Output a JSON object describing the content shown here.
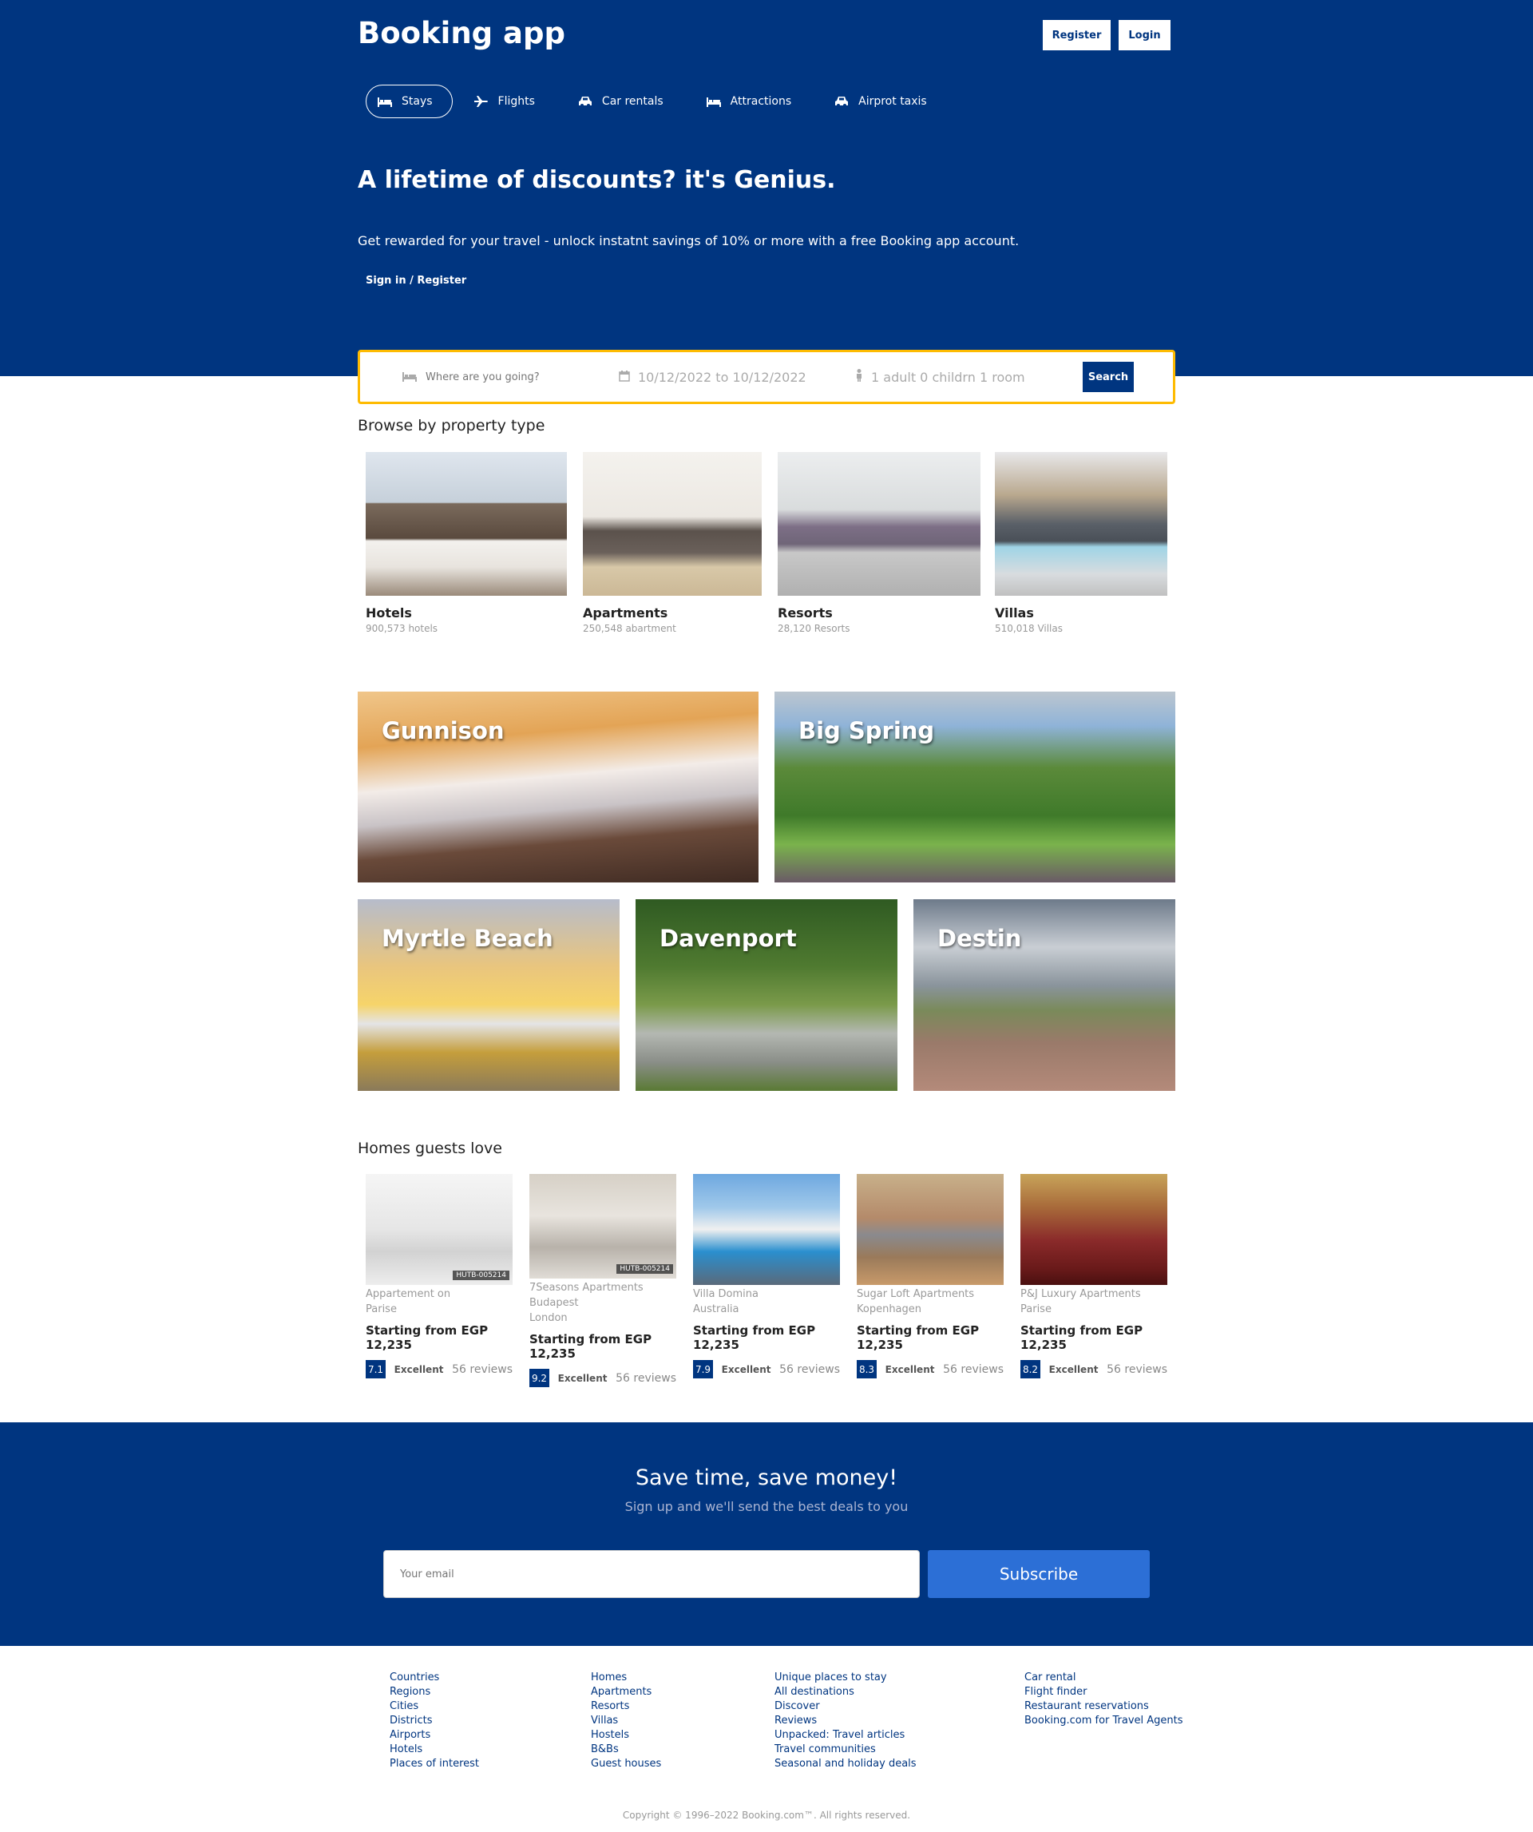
{
  "header": {
    "brand": "Booking app",
    "register_label": "Register",
    "login_label": "Login",
    "nav": [
      {
        "label": "Stays",
        "icon": "bed-icon"
      },
      {
        "label": "Flights",
        "icon": "plane-icon"
      },
      {
        "label": "Car rentals",
        "icon": "car-icon"
      },
      {
        "label": "Attractions",
        "icon": "bed-icon"
      },
      {
        "label": "Airprot taxis",
        "icon": "taxi-icon"
      }
    ],
    "hero_title": "A lifetime of discounts? it's Genius.",
    "hero_subtitle": "Get rewarded for your travel - unlock instatnt savings of 10% or more with a free Booking app account.",
    "hero_link": "Sign in / Register"
  },
  "search": {
    "destination_placeholder": "Where are you going?",
    "dates": "10/12/2022 to 10/12/2022",
    "guests": "1 adult 0 childrn 1 room",
    "button_label": "Search"
  },
  "property_types": {
    "title": "Browse by property type",
    "items": [
      {
        "name": "Hotels",
        "count": "900,573 hotels"
      },
      {
        "name": "Apartments",
        "count": "250,548 abartment"
      },
      {
        "name": "Resorts",
        "count": "28,120 Resorts"
      },
      {
        "name": "Villas",
        "count": "510,018 Villas"
      }
    ]
  },
  "cities": [
    "Gunnison",
    "Big Spring",
    "Myrtle Beach",
    "Davenport",
    "Destin"
  ],
  "homes": {
    "title": "Homes guests love",
    "items": [
      {
        "name": "Appartement on",
        "city": "Parise",
        "price": "Starting from EGP 12,235",
        "score": "7.1",
        "rating": "Excellent",
        "reviews": "56 reviews",
        "tag": "HUTB-005214"
      },
      {
        "name": "7Seasons Apartments Budapest",
        "city": "London",
        "price": "Starting from EGP 12,235",
        "score": "9.2",
        "rating": "Excellent",
        "reviews": "56 reviews",
        "tag": "HUTB-005214"
      },
      {
        "name": "Villa Domina",
        "city": "Australia",
        "price": "Starting from EGP 12,235",
        "score": "7.9",
        "rating": "Excellent",
        "reviews": "56 reviews"
      },
      {
        "name": "Sugar Loft Apartments",
        "city": "Kopenhagen",
        "price": "Starting from EGP 12,235",
        "score": "8.3",
        "rating": "Excellent",
        "reviews": "56 reviews"
      },
      {
        "name": "P&J Luxury Apartments",
        "city": "Parise",
        "price": "Starting from EGP 12,235",
        "score": "8.2",
        "rating": "Excellent",
        "reviews": "56 reviews"
      }
    ]
  },
  "newsletter": {
    "title": "Save time, save money!",
    "subtitle": "Sign up and we'll send the best deals to you",
    "email_placeholder": "Your email",
    "button_label": "Subscribe"
  },
  "footer": {
    "columns": [
      [
        "Countries",
        "Regions",
        "Cities",
        "Districts",
        "Airports",
        "Hotels",
        "Places of interest"
      ],
      [
        "Homes",
        "Apartments",
        "Resorts",
        "Villas",
        "Hostels",
        "B&Bs",
        "Guest houses"
      ],
      [
        "Unique places to stay",
        "All destinations",
        "Discover",
        "Reviews",
        "Unpacked: Travel articles",
        "Travel communities",
        "Seasonal and holiday deals"
      ],
      [
        "Car rental",
        "Flight finder",
        "Restaurant reservations",
        "Booking.com for Travel Agents"
      ]
    ],
    "copyright": "Copyright © 1996–2022 Booking.com™. All rights reserved."
  },
  "colors": {
    "brand_blue": "#003580",
    "search_border": "#febb02",
    "subscribe_blue": "#2c6fd6"
  }
}
